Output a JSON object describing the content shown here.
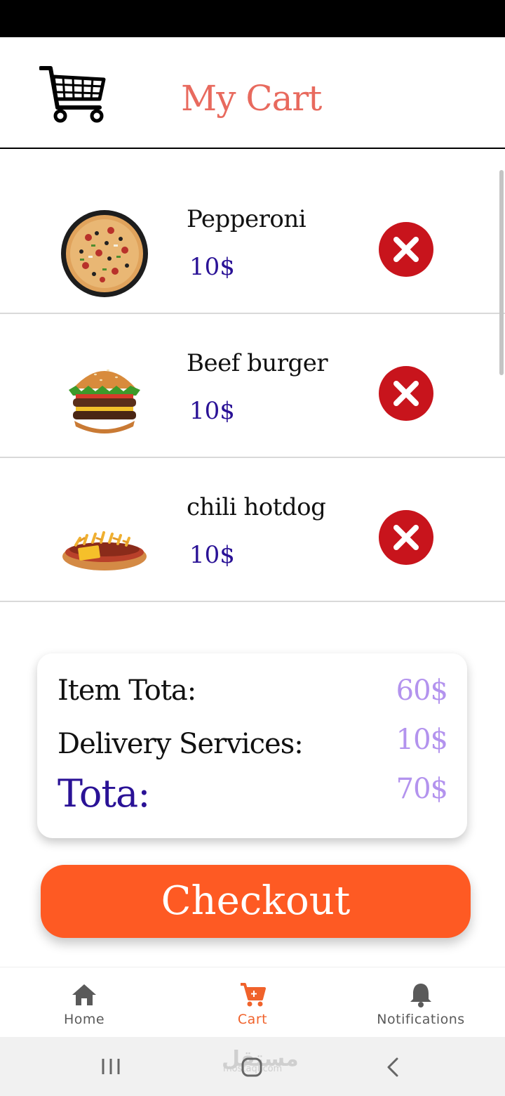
{
  "header": {
    "title": "My Cart",
    "icon": "shopping-cart-icon"
  },
  "cart": {
    "items": [
      {
        "name": "Pepperoni",
        "price": "10$",
        "image": "pizza-image"
      },
      {
        "name": "Beef burger",
        "price": "10$",
        "image": "burger-image"
      },
      {
        "name": "chili hotdog",
        "price": "10$",
        "image": "hotdog-image"
      }
    ],
    "remove_icon": "close-circle-icon"
  },
  "summary": {
    "item_total_label": "Item Tota:",
    "item_total_value": "60$",
    "delivery_label": "Delivery Services:",
    "delivery_value": "10$",
    "total_label": "Tota:",
    "total_value": "70$"
  },
  "checkout": {
    "label": "Checkout"
  },
  "bottom_nav": {
    "items": [
      {
        "label": "Home",
        "icon": "home-icon",
        "active": false
      },
      {
        "label": "Cart",
        "icon": "cart-icon",
        "active": true
      },
      {
        "label": "Notifications",
        "icon": "bell-icon",
        "active": false
      }
    ]
  },
  "watermark": {
    "text": "مستقل",
    "subtext": "mostaql.com"
  },
  "colors": {
    "title": "#e86a5e",
    "price": "#2a1296",
    "summary_value": "#b393ee",
    "checkout_bg": "#fe5a23",
    "remove_bg": "#c8141c",
    "nav_active": "#f0622b",
    "nav_inactive": "#5a5a5a"
  }
}
